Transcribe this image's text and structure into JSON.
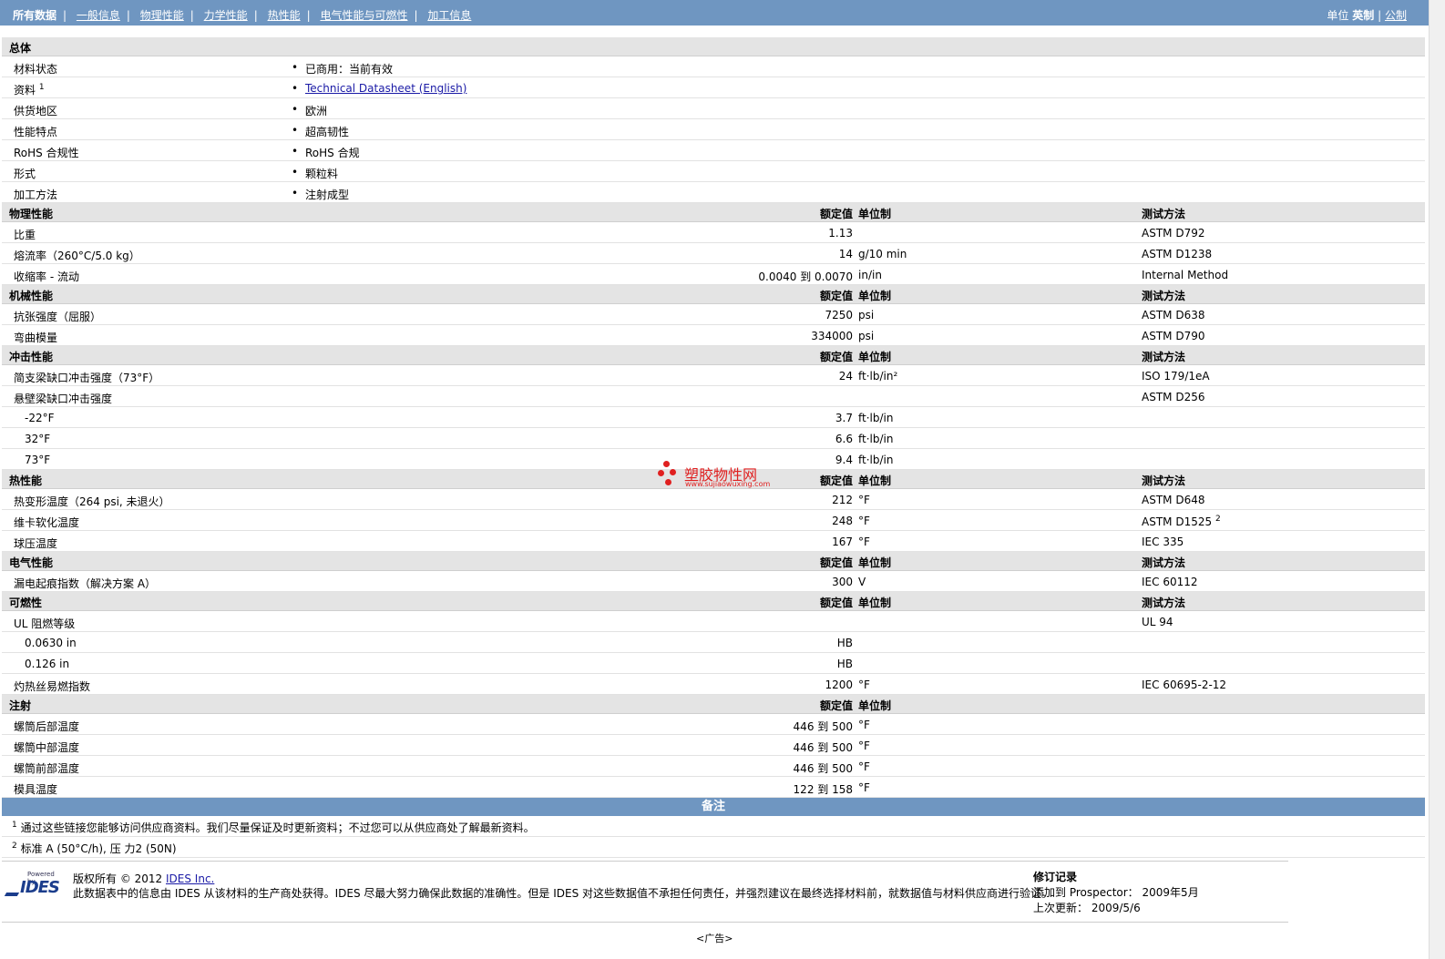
{
  "nav": {
    "items": [
      "所有数据",
      "一般信息",
      "物理性能",
      "力学性能",
      "热性能",
      "电气性能与可燃性",
      "加工信息"
    ],
    "units_label": "单位",
    "unit_english": "英制",
    "unit_metric": "公制"
  },
  "headers": {
    "nominal": "额定值",
    "unit": "单位制",
    "method": "测试方法"
  },
  "general": {
    "title": "总体",
    "rows": [
      {
        "label": "材料状态",
        "value": "已商用：当前有效"
      },
      {
        "label": "资料",
        "sup": "1",
        "value": "Technical Datasheet (English)"
      },
      {
        "label": "供货地区",
        "value": "欧洲"
      },
      {
        "label": "性能特点",
        "value": "超高韧性"
      },
      {
        "label": "RoHS 合规性",
        "value": "RoHS 合规"
      },
      {
        "label": "形式",
        "value": "颗粒料"
      },
      {
        "label": "加工方法",
        "value": "注射成型"
      }
    ]
  },
  "physical": {
    "title": "物理性能",
    "rows": [
      {
        "label": "比重",
        "value": "1.13",
        "unit": "",
        "method": "ASTM D792"
      },
      {
        "label": "熔流率（260°C/5.0 kg）",
        "value": "14",
        "unit": "g/10 min",
        "method": "ASTM D1238"
      },
      {
        "label": "收缩率 - 流动",
        "value": "0.0040 到 0.0070",
        "unit": "in/in",
        "method": "Internal Method"
      }
    ]
  },
  "mechanical": {
    "title": "机械性能",
    "rows": [
      {
        "label": "抗张强度（屈服）",
        "value": "7250",
        "unit": "psi",
        "method": "ASTM D638"
      },
      {
        "label": "弯曲模量",
        "value": "334000",
        "unit": "psi",
        "method": "ASTM D790"
      }
    ]
  },
  "impact": {
    "title": "冲击性能",
    "rows": [
      {
        "label": "简支梁缺口冲击强度（73°F）",
        "value": "24",
        "unit": "ft·lb/in²",
        "method": "ISO 179/1eA"
      },
      {
        "label": "悬壁梁缺口冲击强度",
        "value": "",
        "unit": "",
        "method": "ASTM D256"
      },
      {
        "label": "-22°F",
        "sub": true,
        "value": "3.7",
        "unit": "ft·lb/in",
        "method": ""
      },
      {
        "label": "32°F",
        "sub": true,
        "value": "6.6",
        "unit": "ft·lb/in",
        "method": ""
      },
      {
        "label": "73°F",
        "sub": true,
        "value": "9.4",
        "unit": "ft·lb/in",
        "method": ""
      }
    ]
  },
  "thermal": {
    "title": "热性能",
    "rows": [
      {
        "label": "热变形温度（264 psi, 未退火）",
        "value": "212",
        "unit": "°F",
        "method": "ASTM D648"
      },
      {
        "label": "维卡软化温度",
        "value": "248",
        "unit": "°F",
        "method": "ASTM D1525",
        "sup": "2"
      },
      {
        "label": "球压温度",
        "value": "167",
        "unit": "°F",
        "method": "IEC 335"
      }
    ]
  },
  "electrical": {
    "title": "电气性能",
    "rows": [
      {
        "label": "漏电起痕指数（解决方案 A）",
        "value": "300",
        "unit": "V",
        "method": "IEC 60112"
      }
    ]
  },
  "flammability": {
    "title": "可燃性",
    "rows": [
      {
        "label": "UL 阻燃等级",
        "value": "",
        "unit": "",
        "method": "UL 94"
      },
      {
        "label": "0.0630 in",
        "sub": true,
        "value": "HB",
        "unit": "",
        "method": ""
      },
      {
        "label": "0.126 in",
        "sub": true,
        "value": "HB",
        "unit": "",
        "method": ""
      },
      {
        "label": "灼热丝易燃指数",
        "value": "1200",
        "unit": "°F",
        "method": "IEC 60695-2-12"
      }
    ]
  },
  "injection": {
    "title": "注射",
    "rows": [
      {
        "label": "螺筒后部温度",
        "value": "446 到 500",
        "unit": "°F"
      },
      {
        "label": "螺筒中部温度",
        "value": "446 到 500",
        "unit": "°F"
      },
      {
        "label": "螺筒前部温度",
        "value": "446 到 500",
        "unit": "°F"
      },
      {
        "label": "模具温度",
        "value": "122 到 158",
        "unit": "°F"
      }
    ]
  },
  "notes": {
    "title": "备注",
    "items": [
      {
        "sup": "1",
        "text": "通过这些链接您能够访问供应商资料。我们尽量保证及时更新资料；不过您可以从供应商处了解最新资料。"
      },
      {
        "sup": "2",
        "text": "标准 A (50°C/h), 压 力2 (50N)"
      }
    ]
  },
  "footer": {
    "logo_powered": "Powered by",
    "logo_text": "IDES",
    "copyright_prefix": "版权所有 © 2012",
    "copyright_link": "IDES Inc.",
    "disclaimer": "此数据表中的信息由 IDES 从该材料的生产商处获得。IDES 尽最大努力确保此数据的准确性。但是 IDES 对这些数据值不承担任何责任，并强烈建议在最终选择材料前，就数据值与材料供应商进行验证。",
    "revision_title": "修订记录",
    "added_label": "添加到 Prospector：",
    "added_value": "2009年5月",
    "updated_label": "上次更新：",
    "updated_value": "2009/5/6"
  },
  "ad": "<广告>",
  "watermark": {
    "text": "塑胶物性网",
    "url": "www.sujiaowuxing.com"
  }
}
